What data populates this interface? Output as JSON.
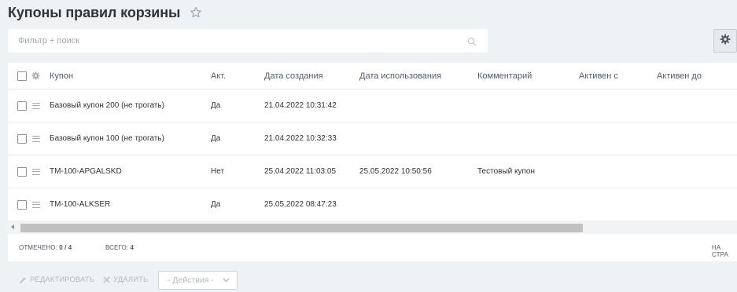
{
  "header": {
    "title": "Купоны правил корзины",
    "favorite_icon": "star-icon"
  },
  "search": {
    "placeholder": "Фильтр + поиск",
    "icon": "search-icon"
  },
  "grid_settings_icon": "gear-icon",
  "grid": {
    "columns": [
      "Купон",
      "Акт.",
      "Дата создания",
      "Дата использования",
      "Комментарий",
      "Активен с",
      "Активен до"
    ],
    "rows": [
      {
        "coupon": "Базовый купон 200 (не трогать)",
        "active": "Да",
        "created": "21.04.2022 10:31:42",
        "used": "",
        "comment": "",
        "from": "",
        "to": ""
      },
      {
        "coupon": "Базовый купон 100 (не трогать)",
        "active": "Да",
        "created": "21.04.2022 10:32:33",
        "used": "",
        "comment": "",
        "from": "",
        "to": ""
      },
      {
        "coupon": "TM-100-APGALSKD",
        "active": "Нет",
        "created": "25.04.2022 11:03:05",
        "used": "25.05.2022 10:50:56",
        "comment": "Тестовый купон",
        "from": "",
        "to": ""
      },
      {
        "coupon": "TM-100-ALKSER",
        "active": "Да",
        "created": "25.05.2022 08:47:23",
        "used": "",
        "comment": "",
        "from": "",
        "to": ""
      }
    ]
  },
  "footer": {
    "selected_label": "Отмечено:",
    "selected_value": "0 / 4",
    "total_label": "Всего:",
    "total_value": "4",
    "per_page_label": "На стра"
  },
  "actions": {
    "edit_label": "Редактировать",
    "delete_label": "Удалить",
    "actions_select_value": "- Действия -"
  },
  "colors": {
    "background": "#eef2f4",
    "panel": "#ffffff",
    "scroll_thumb": "#c1c1c1",
    "disabled_text": "#b6bcc1"
  }
}
